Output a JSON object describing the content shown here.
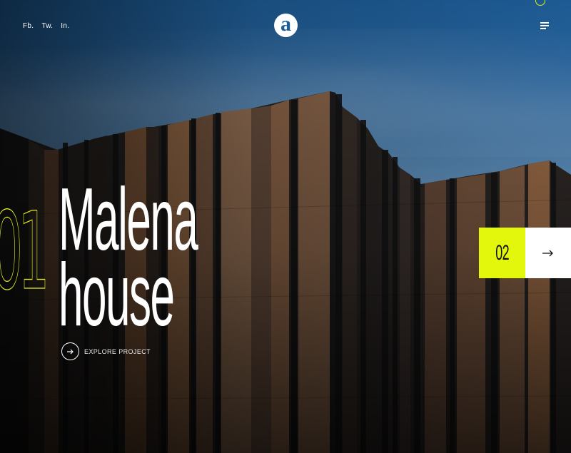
{
  "social": {
    "links": [
      "Fb.",
      "Tw.",
      "In."
    ]
  },
  "logo": {
    "letter": "a"
  },
  "hero": {
    "index": "01",
    "title_line1": "Malena",
    "title_line2": "house",
    "explore_label": "EXPLORE PROJECT"
  },
  "slider": {
    "next_number": "02"
  },
  "icons": {
    "menu": "hamburger-menu-icon",
    "explore": "arrow-right-icon",
    "next": "arrow-right-icon",
    "top": "circle-outline-icon"
  },
  "colors": {
    "accent": "#e2f70b",
    "sky_top": "#1d5a93",
    "facade": "#8a6446",
    "logo_letter": "#1e5d9c"
  }
}
